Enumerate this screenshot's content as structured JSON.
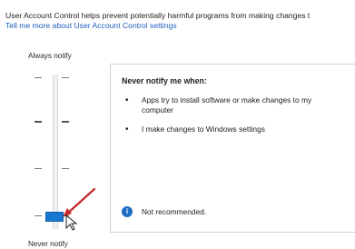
{
  "intro": {
    "description": "User Account Control helps prevent potentially harmful programs from making changes t",
    "learn_more_link": "Tell me more about User Account Control settings"
  },
  "slider": {
    "top_label": "Always notify",
    "bottom_label": "Never notify",
    "levels": 4,
    "selected_level": 1
  },
  "panel": {
    "heading": "Never notify me when:",
    "items": [
      "Apps try to install software or make changes to my computer",
      "I make changes to Windows settings"
    ],
    "status_text": "Not recommended.",
    "status_icon": "info-icon"
  },
  "colors": {
    "accent": "#1677d2",
    "link": "#1f5fbf",
    "annotation": "#c62828"
  }
}
